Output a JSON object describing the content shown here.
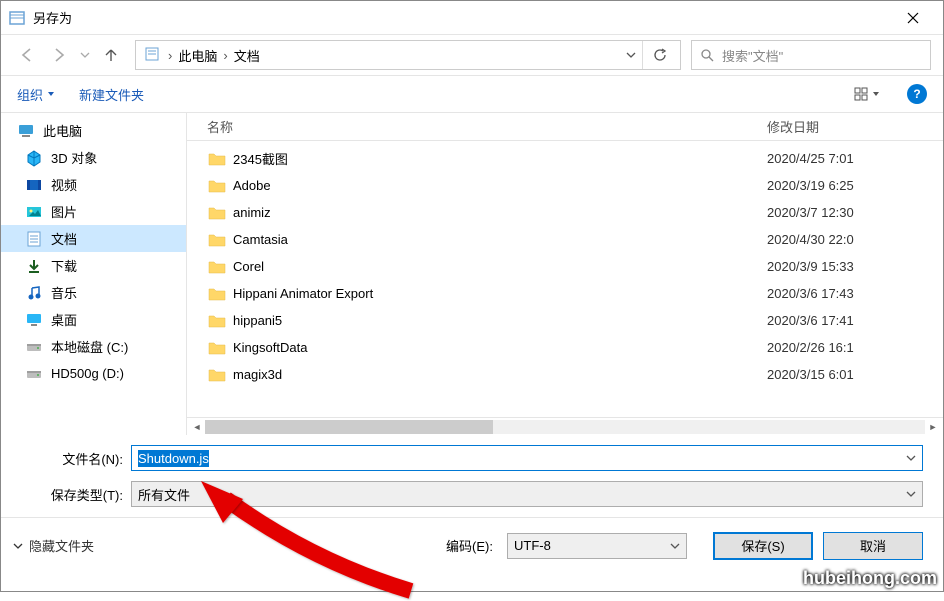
{
  "window": {
    "title": "另存为"
  },
  "breadcrumb": {
    "root": "此电脑",
    "folder": "文档"
  },
  "search": {
    "placeholder": "搜索\"文档\""
  },
  "toolbar": {
    "organize": "组织",
    "new_folder": "新建文件夹"
  },
  "tree": {
    "root": "此电脑",
    "items": [
      {
        "label": "3D 对象",
        "icon": "3d"
      },
      {
        "label": "视频",
        "icon": "video"
      },
      {
        "label": "图片",
        "icon": "pictures"
      },
      {
        "label": "文档",
        "icon": "documents",
        "selected": true
      },
      {
        "label": "下载",
        "icon": "downloads"
      },
      {
        "label": "音乐",
        "icon": "music"
      },
      {
        "label": "桌面",
        "icon": "desktop"
      },
      {
        "label": "本地磁盘 (C:)",
        "icon": "drive"
      },
      {
        "label": "HD500g (D:)",
        "icon": "drive"
      }
    ]
  },
  "columns": {
    "name": "名称",
    "date": "修改日期"
  },
  "files": [
    {
      "name": "2345截图",
      "date": "2020/4/25 7:01"
    },
    {
      "name": "Adobe",
      "date": "2020/3/19 6:25"
    },
    {
      "name": "animiz",
      "date": "2020/3/7 12:30"
    },
    {
      "name": "Camtasia",
      "date": "2020/4/30 22:0"
    },
    {
      "name": "Corel",
      "date": "2020/3/9 15:33"
    },
    {
      "name": "Hippani Animator Export",
      "date": "2020/3/6 17:43"
    },
    {
      "name": "hippani5",
      "date": "2020/3/6 17:41"
    },
    {
      "name": "KingsoftData",
      "date": "2020/2/26 16:1"
    },
    {
      "name": "magix3d",
      "date": "2020/3/15 6:01"
    }
  ],
  "fields": {
    "filename_label": "文件名(N):",
    "filename_value": "Shutdown.js",
    "type_label": "保存类型(T):",
    "type_value": "所有文件",
    "encoding_label": "编码(E):",
    "encoding_value": "UTF-8"
  },
  "buttons": {
    "save": "保存(S)",
    "cancel": "取消",
    "hide_folders": "隐藏文件夹"
  },
  "watermark": "hubeihong.com"
}
